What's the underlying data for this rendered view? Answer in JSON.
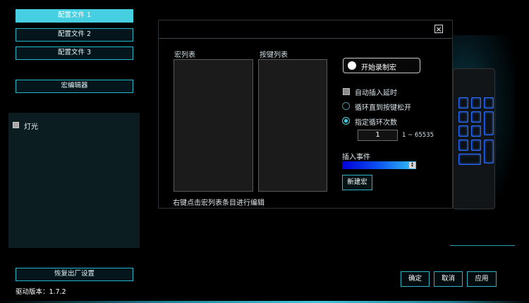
{
  "profiles": [
    "配置文件 1",
    "配置文件 2",
    "配置文件 3"
  ],
  "macro_editor_button": "宏编辑器",
  "lighting_label": "灯光",
  "restore_defaults_button": "恢复出厂设置",
  "driver_version": "驱动版本：1.7.2",
  "dialog": {
    "macro_list_label": "宏列表",
    "key_list_label": "按键列表",
    "record_button": "开始录制宏",
    "auto_insert_delay": "自动插入延时",
    "loop_until_release": "循环直到按键松开",
    "specify_loop_count": "指定循环次数",
    "loop_count_value": "1",
    "loop_range": "1 ~ 65535",
    "insert_event_label": "插入事件",
    "new_macro_button": "新建宏",
    "hint": "右键点击宏列表条目进行编辑",
    "close_icon": "close-icon"
  },
  "footer": {
    "ok": "确定",
    "cancel": "取消",
    "apply": "应用"
  },
  "colors": {
    "accent": "#46cfe0",
    "key_glow": "#2a6cff"
  }
}
